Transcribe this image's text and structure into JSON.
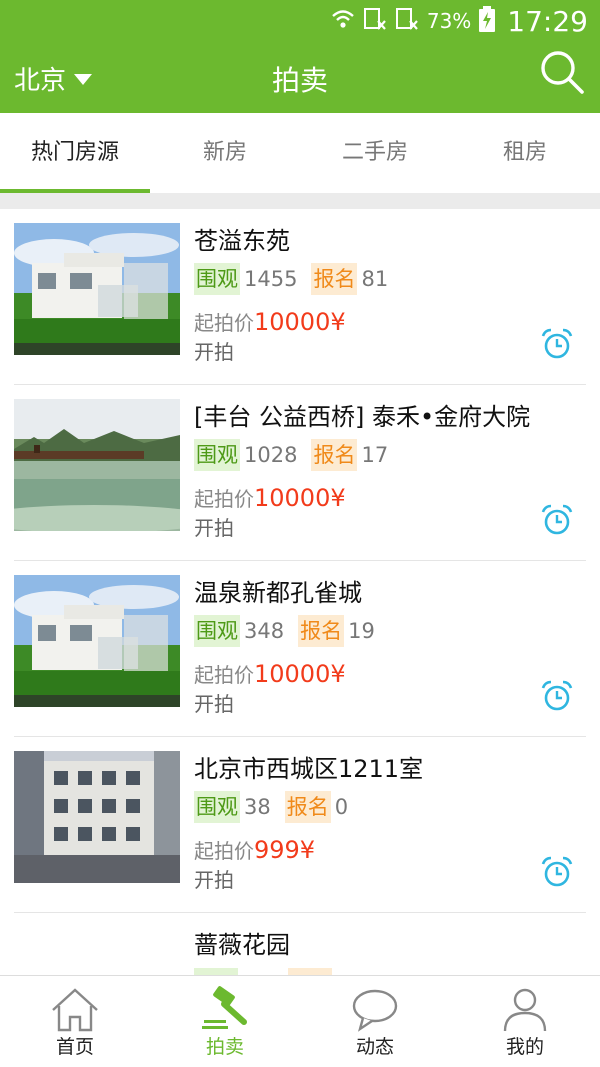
{
  "status_bar": {
    "battery": "73%",
    "time": "17:29"
  },
  "header": {
    "city": "北京",
    "title": "拍卖"
  },
  "tabs": [
    {
      "label": "热门房源",
      "active": true
    },
    {
      "label": "新房",
      "active": false
    },
    {
      "label": "二手房",
      "active": false
    },
    {
      "label": "租房",
      "active": false
    }
  ],
  "listings": [
    {
      "name": "苍溢东苑",
      "views_label": "围观",
      "views": "1455",
      "sign_label": "报名",
      "sign": "81",
      "price_label": "起拍价",
      "price": "10000¥",
      "status": "开拍",
      "image": "villa"
    },
    {
      "name": "[丰台 公益西桥] 泰禾•金府大院",
      "views_label": "围观",
      "views": "1028",
      "sign_label": "报名",
      "sign": "17",
      "price_label": "起拍价",
      "price": "10000¥",
      "status": "开拍",
      "image": "lake"
    },
    {
      "name": "温泉新都孔雀城",
      "views_label": "围观",
      "views": "348",
      "sign_label": "报名",
      "sign": "19",
      "price_label": "起拍价",
      "price": "10000¥",
      "status": "开拍",
      "image": "villa"
    },
    {
      "name": "北京市西城区1211室",
      "views_label": "围观",
      "views": "38",
      "sign_label": "报名",
      "sign": "0",
      "price_label": "起拍价",
      "price": "999¥",
      "status": "开拍",
      "image": "building"
    },
    {
      "name": "蔷薇花园",
      "views_label": "",
      "views": "",
      "sign_label": "",
      "sign": "",
      "price_label": "",
      "price": "",
      "status": "",
      "image": ""
    }
  ],
  "bottom_nav": [
    {
      "label": "首页",
      "icon": "home-icon",
      "active": false
    },
    {
      "label": "拍卖",
      "icon": "gavel-icon",
      "active": true
    },
    {
      "label": "动态",
      "icon": "chat-bubble-icon",
      "active": false
    },
    {
      "label": "我的",
      "icon": "person-icon",
      "active": false
    }
  ],
  "colors": {
    "brand": "#6cb92f",
    "price": "#f23b1b",
    "views_tag": "#4e9a17",
    "sign_tag": "#f08a1a",
    "alarm": "#2fb6e0"
  }
}
